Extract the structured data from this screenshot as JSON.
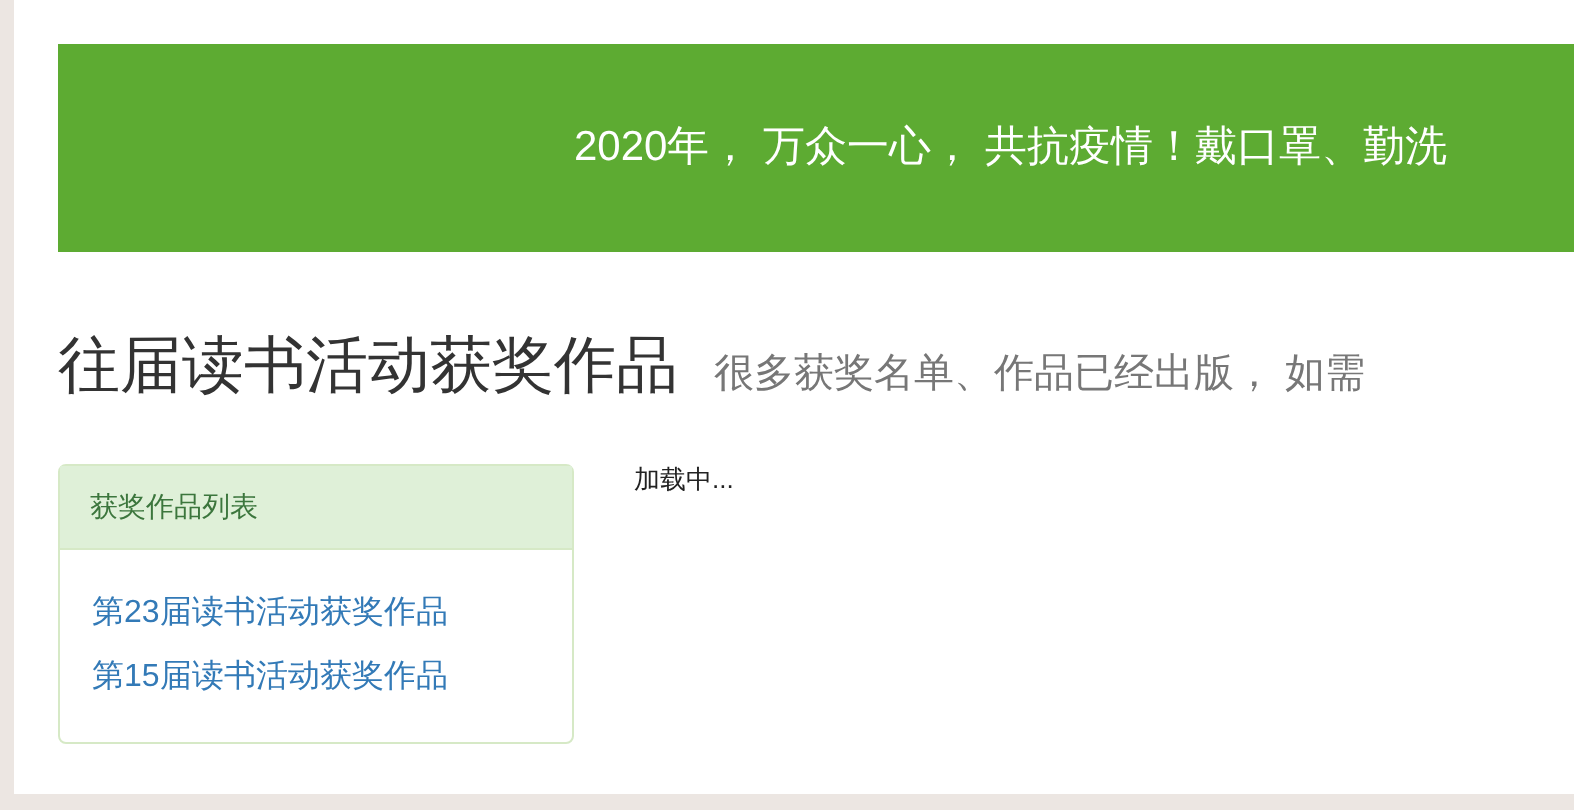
{
  "banner": {
    "text": "2020年， 万众一心， 共抗疫情！戴口罩、勤洗"
  },
  "heading": {
    "title": "往届读书活动获奖作品",
    "subtitle": "很多获奖名单、作品已经出版， 如需"
  },
  "panel": {
    "title": "获奖作品列表",
    "links": [
      {
        "text": "第23届读书活动获奖作品"
      },
      {
        "text": "第15届读书活动获奖作品"
      }
    ]
  },
  "content": {
    "status": "加载中..."
  }
}
